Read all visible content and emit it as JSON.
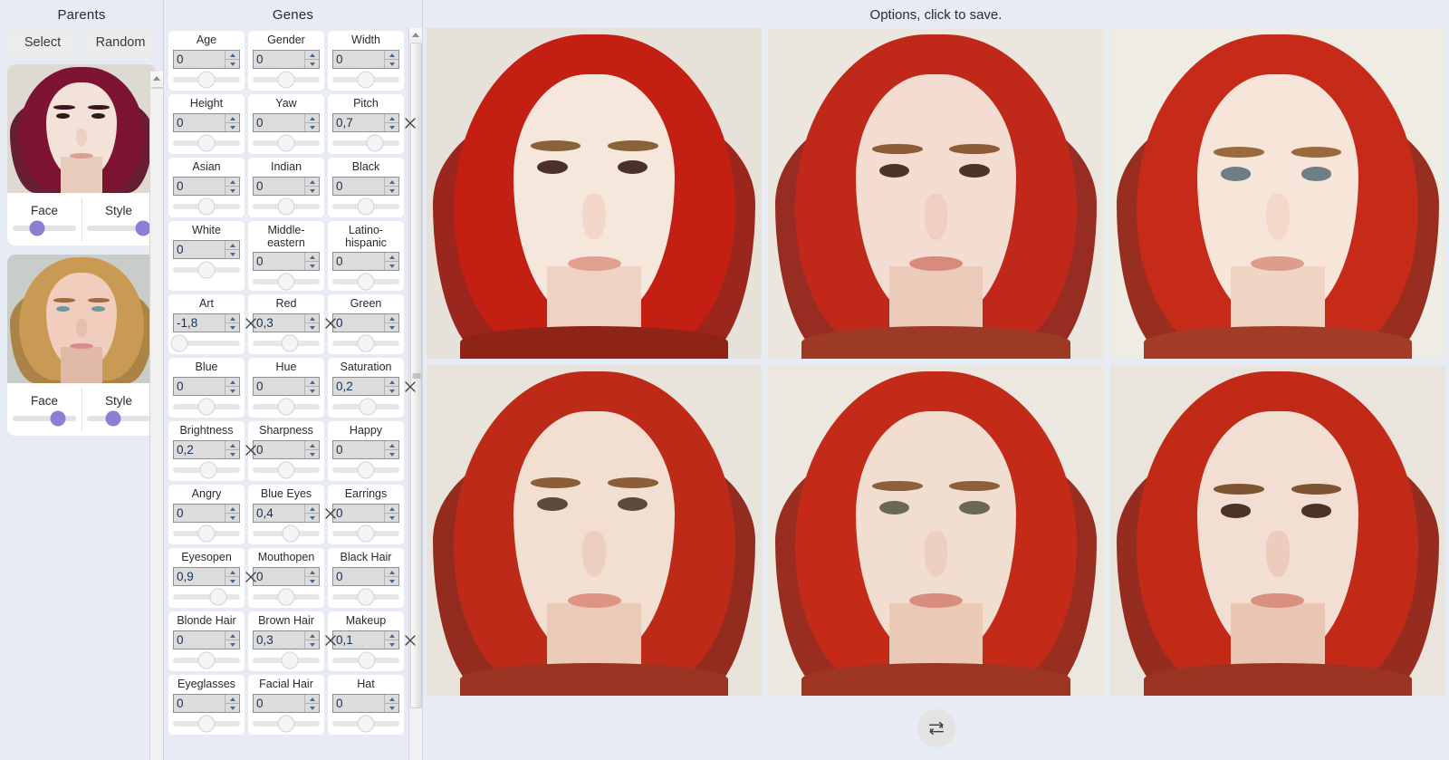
{
  "parents": {
    "title": "Parents",
    "select_label": "Select",
    "random_label": "Random",
    "slider_face_label": "Face",
    "slider_style_label": "Style",
    "items": [
      {
        "name": "parent-1",
        "face_value": 38,
        "style_value": 88,
        "colors": {
          "bg": "#ded9d2",
          "hair": "#7d1431",
          "hair_shadow": "#5c0d24",
          "skin": "#f3e2d8",
          "brow": "#3a1620",
          "eye": "#2c1a1c",
          "mouth": "#d9a18f",
          "neck": "#e8cdbd"
        }
      },
      {
        "name": "parent-2",
        "face_value": 72,
        "style_value": 42,
        "colors": {
          "bg": "#c9cdca",
          "hair": "#c99a53",
          "hair_shadow": "#a87d3c",
          "skin": "#f0cdbd",
          "brow": "#a06a3c",
          "eye": "#6f9a9b",
          "mouth": "#d98b90",
          "neck": "#e1b9a7"
        }
      }
    ]
  },
  "genes": {
    "title": "Genes",
    "clear_icon": "close-x-icon",
    "items": [
      {
        "label": "Age",
        "value": "0",
        "knob": 50,
        "clearable": false
      },
      {
        "label": "Gender",
        "value": "0",
        "knob": 50,
        "clearable": false
      },
      {
        "label": "Width",
        "value": "0",
        "knob": 50,
        "clearable": false
      },
      {
        "label": "Height",
        "value": "0",
        "knob": 50,
        "clearable": false
      },
      {
        "label": "Yaw",
        "value": "0",
        "knob": 50,
        "clearable": false
      },
      {
        "label": "Pitch",
        "value": "0,7",
        "knob": 64,
        "clearable": true
      },
      {
        "label": "Asian",
        "value": "0",
        "knob": 50,
        "clearable": false
      },
      {
        "label": "Indian",
        "value": "0",
        "knob": 50,
        "clearable": false
      },
      {
        "label": "Black",
        "value": "0",
        "knob": 50,
        "clearable": false
      },
      {
        "label": "White",
        "value": "0",
        "knob": 50,
        "clearable": false
      },
      {
        "label": "Middle-\neastern",
        "value": "0",
        "knob": 50,
        "clearable": false
      },
      {
        "label": "Latino-\nhispanic",
        "value": "0",
        "knob": 50,
        "clearable": false
      },
      {
        "label": "Art",
        "value": "-1,8",
        "knob": 10,
        "clearable": true
      },
      {
        "label": "Red",
        "value": "0,3",
        "knob": 55,
        "clearable": true
      },
      {
        "label": "Green",
        "value": "0",
        "knob": 50,
        "clearable": false
      },
      {
        "label": "Blue",
        "value": "0",
        "knob": 50,
        "clearable": false
      },
      {
        "label": "Hue",
        "value": "0",
        "knob": 50,
        "clearable": false
      },
      {
        "label": "Saturation",
        "value": "0,2",
        "knob": 53,
        "clearable": true
      },
      {
        "label": "Brightness",
        "value": "0,2",
        "knob": 53,
        "clearable": true
      },
      {
        "label": "Sharpness",
        "value": "0",
        "knob": 50,
        "clearable": false
      },
      {
        "label": "Happy",
        "value": "0",
        "knob": 50,
        "clearable": false
      },
      {
        "label": "Angry",
        "value": "0",
        "knob": 50,
        "clearable": false
      },
      {
        "label": "Blue Eyes",
        "value": "0,4",
        "knob": 57,
        "clearable": true
      },
      {
        "label": "Earrings",
        "value": "0",
        "knob": 50,
        "clearable": false
      },
      {
        "label": "Eyesopen",
        "value": "0,9",
        "knob": 68,
        "clearable": true
      },
      {
        "label": "Mouthopen",
        "value": "0",
        "knob": 50,
        "clearable": false
      },
      {
        "label": "Black Hair",
        "value": "0",
        "knob": 50,
        "clearable": false
      },
      {
        "label": "Blonde Hair",
        "value": "0",
        "knob": 50,
        "clearable": false
      },
      {
        "label": "Brown Hair",
        "value": "0,3",
        "knob": 55,
        "clearable": true
      },
      {
        "label": "Makeup",
        "value": "0,1",
        "knob": 52,
        "clearable": true
      },
      {
        "label": "Eyeglasses",
        "value": "0",
        "knob": 50,
        "clearable": false
      },
      {
        "label": "Facial Hair",
        "value": "0",
        "knob": 50,
        "clearable": false
      },
      {
        "label": "Hat",
        "value": "0",
        "knob": 50,
        "clearable": false
      }
    ]
  },
  "options": {
    "title": "Options, click to save.",
    "swap_icon": "repeat-swap-icon",
    "cells": [
      {
        "name": "option-1",
        "bg": "#e6e2d9",
        "hair": "#c31f13",
        "hair_shadow": "#94160d",
        "skin": "#f6e7dd",
        "brow": "#8a6238",
        "eye": "#4a3028",
        "mouth": "#e0a08e",
        "neck": "#f0d2c2",
        "shoulder": "#8e2418"
      },
      {
        "name": "option-2",
        "bg": "#ebe7de",
        "hair": "#c0291a",
        "hair_shadow": "#8e1c11",
        "skin": "#f3dcd2",
        "brow": "#8c5c38",
        "eye": "#4b332a",
        "mouth": "#d88b7c",
        "neck": "#eccbbb",
        "shoulder": "#9c3a26"
      },
      {
        "name": "option-3",
        "bg": "#efece4",
        "hair": "#c52b18",
        "hair_shadow": "#8f1d0f",
        "skin": "#f7e5da",
        "brow": "#996a3e",
        "eye": "#6d7f85",
        "mouth": "#dd9c8c",
        "neck": "#f0d4c4",
        "shoulder": "#a33c27"
      },
      {
        "name": "option-4",
        "bg": "#e8e4dc",
        "hair": "#be2a18",
        "hair_shadow": "#8b1c0e",
        "skin": "#f3dfd2",
        "brow": "#8a5e36",
        "eye": "#5d4a38",
        "mouth": "#dd9484",
        "neck": "#ebcab8",
        "shoulder": "#9a3322"
      },
      {
        "name": "option-5",
        "bg": "#ece8e0",
        "hair": "#c32a17",
        "hair_shadow": "#911d0f",
        "skin": "#f2ddd1",
        "brow": "#8d6039",
        "eye": "#6a6a54",
        "mouth": "#d98d7e",
        "neck": "#eac9b7",
        "shoulder": "#9d3523"
      },
      {
        "name": "option-6",
        "bg": "#e9e5dd",
        "hair": "#c22a18",
        "hair_shadow": "#8e1c0f",
        "skin": "#f2ded2",
        "brow": "#7e5432",
        "eye": "#4a342a",
        "mouth": "#d9907f",
        "neck": "#e9c6b4",
        "shoulder": "#9b3322"
      }
    ]
  },
  "theme": {
    "bg": "#e7ebf4",
    "card_bg": "#ffffff",
    "accent": "#8b7fd4",
    "text": "#2b2b2b"
  }
}
